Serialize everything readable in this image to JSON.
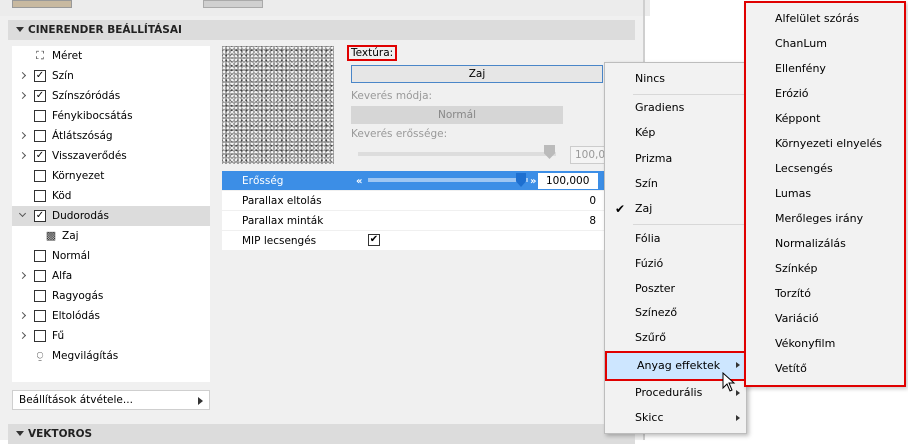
{
  "section_title": "CINERENDER BEÁLLÍTÁSAI",
  "bottom_section_title": "VEKTOROS",
  "tree": [
    {
      "label": "Méret",
      "icon": "size-icon",
      "checkbox": null,
      "expander": false
    },
    {
      "label": "Szín",
      "checkbox": true,
      "expander": true
    },
    {
      "label": "Színszóródás",
      "checkbox": true,
      "expander": true
    },
    {
      "label": "Fénykibocsátás",
      "checkbox": false,
      "expander": false
    },
    {
      "label": "Átlátszóság",
      "checkbox": false,
      "expander": true
    },
    {
      "label": "Visszaverődés",
      "checkbox": true,
      "expander": true
    },
    {
      "label": "Környezet",
      "checkbox": false,
      "expander": false
    },
    {
      "label": "Köd",
      "checkbox": false,
      "expander": false
    },
    {
      "label": "Dudorodás",
      "checkbox": true,
      "expander": true,
      "selected": true,
      "open": true
    },
    {
      "label": "Zaj",
      "icon": "noise-icon",
      "checkbox": null,
      "sub": true
    },
    {
      "label": "Normál",
      "checkbox": false,
      "expander": false
    },
    {
      "label": "Alfa",
      "checkbox": false,
      "expander": true
    },
    {
      "label": "Ragyogás",
      "checkbox": false,
      "expander": false
    },
    {
      "label": "Eltolódás",
      "checkbox": false,
      "expander": true
    },
    {
      "label": "Fű",
      "checkbox": false,
      "expander": true
    },
    {
      "label": "Megvilágítás",
      "icon": "lighting-icon",
      "checkbox": null,
      "expander": false
    }
  ],
  "transfer_label": "Beállítások átvétele...",
  "texture": {
    "label": "Textúra:",
    "button": "Zaj",
    "blend_mode_label": "Keverés módja:",
    "blend_mode_value": "Normál",
    "blend_strength_label": "Keverés erőssége:",
    "blend_strength_value": "100,0"
  },
  "params": [
    {
      "label": "Erősség",
      "value": "100,000",
      "highlight": true
    },
    {
      "label": "Parallax eltolás",
      "value": "0"
    },
    {
      "label": "Parallax minták",
      "value": "8"
    },
    {
      "label": "MIP lecsengés",
      "value": "✔"
    }
  ],
  "menu1": [
    "Nincs",
    "Gradiens",
    "Kép",
    "Prizma",
    "Szín",
    "Zaj",
    "Fólia",
    "Fúzió",
    "Poszter",
    "Színező",
    "Szűrő",
    "Anyag effektek",
    "Procedurális",
    "Skicc"
  ],
  "menu1_checked": "Zaj",
  "menu2": [
    "Alfelület szórás",
    "ChanLum",
    "Ellenfény",
    "Erózió",
    "Képpont",
    "Környezeti elnyelés",
    "Lecsengés",
    "Lumas",
    "Merőleges irány",
    "Normalizálás",
    "Színkép",
    "Torzító",
    "Variáció",
    "Vékonyfilm",
    "Vetítő"
  ]
}
